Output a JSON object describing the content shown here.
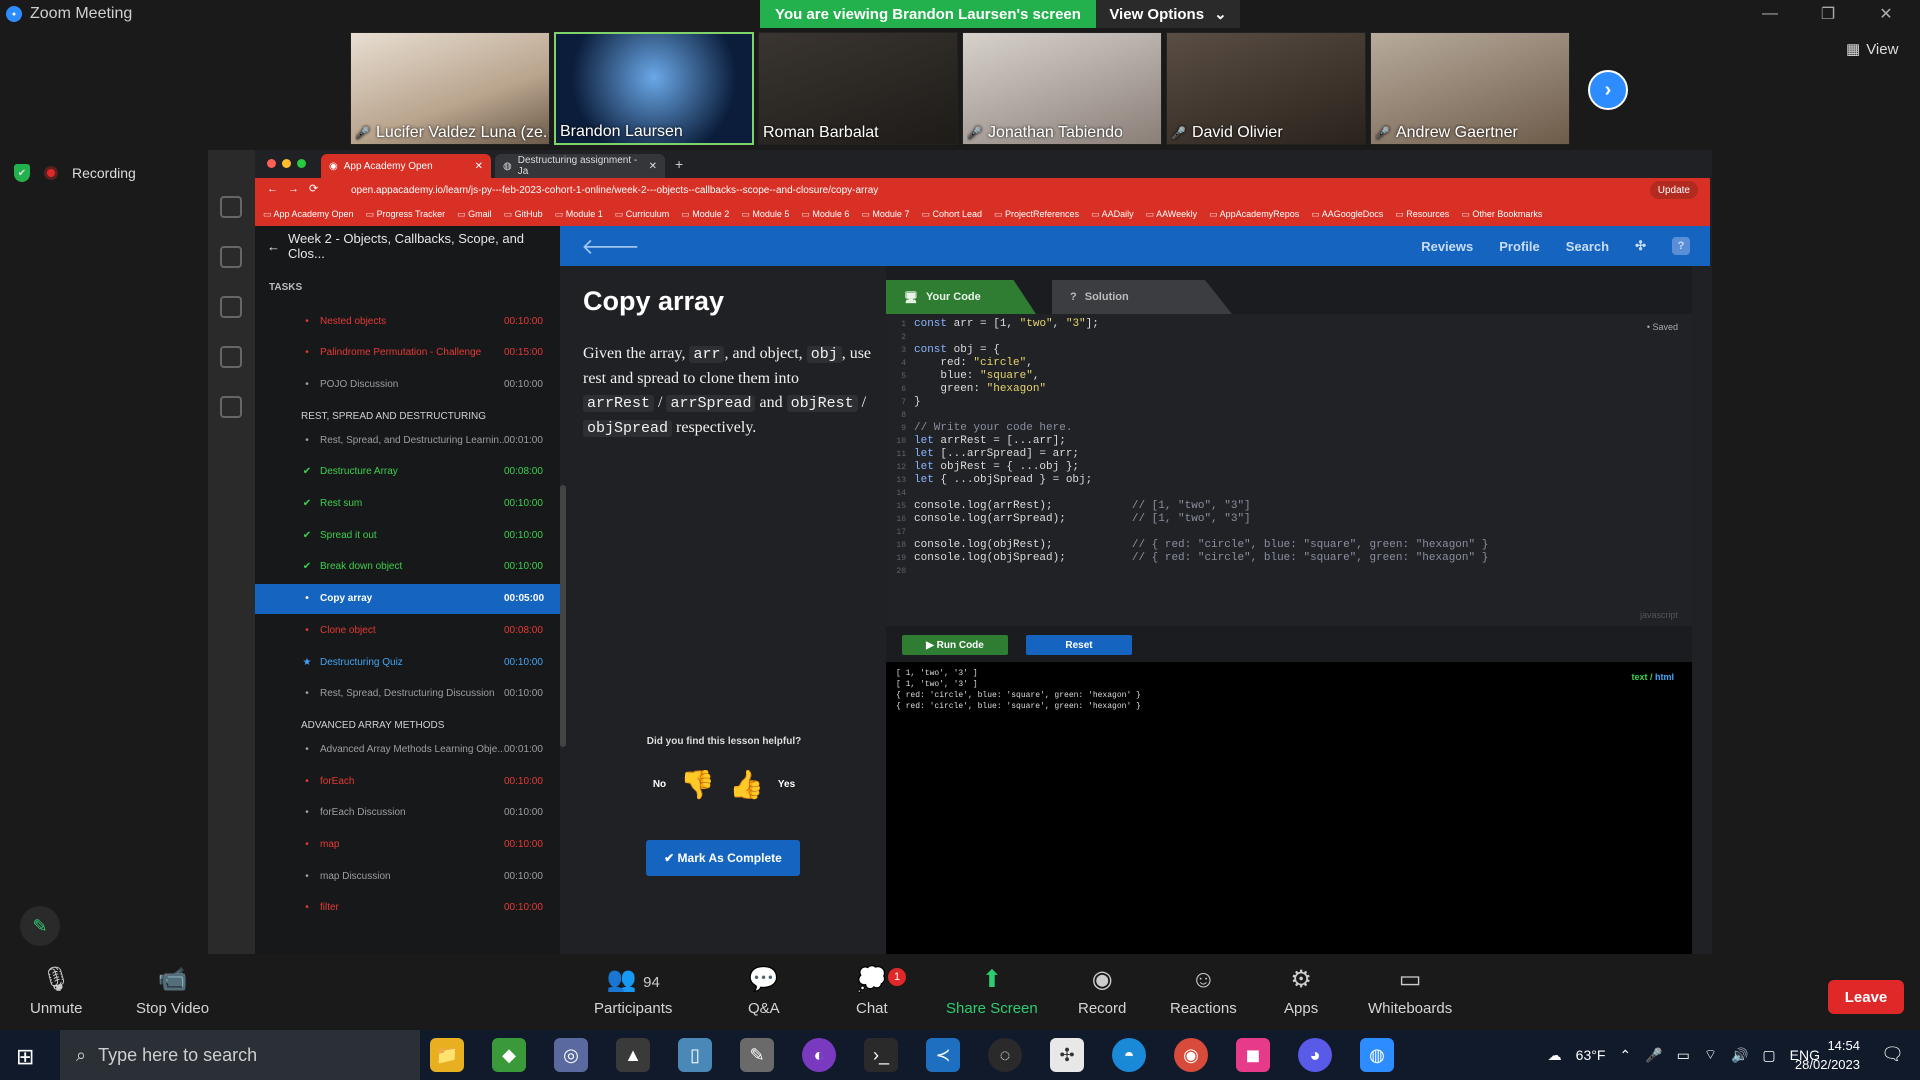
{
  "window": {
    "title": "Zoom Meeting"
  },
  "banner": {
    "viewing": "You are viewing Brandon Laursen's screen",
    "view_options": "View Options"
  },
  "participants": [
    {
      "name": "Lucifer Valdez Luna (ze...",
      "muted": true
    },
    {
      "name": "Brandon Laursen",
      "muted": false
    },
    {
      "name": "Roman Barbalat",
      "muted": false
    },
    {
      "name": "Jonathan Tabiendo",
      "muted": true
    },
    {
      "name": "David Olivier",
      "muted": true
    },
    {
      "name": "Andrew Gaertner",
      "muted": true
    }
  ],
  "view_button": "View",
  "recording": "Recording",
  "browser": {
    "tabs": [
      {
        "label": "App Academy Open"
      },
      {
        "label": "Destructuring assignment - Ja"
      }
    ],
    "url": "open.appacademy.io/learn/js-py---feb-2023-cohort-1-online/week-2---objects--callbacks--scope--and-closure/copy-array",
    "update": "Update",
    "bookmarks": [
      "App Academy Open",
      "Progress Tracker",
      "Gmail",
      "GitHub",
      "Module 1",
      "Curriculum",
      "Module 2",
      "Module 5",
      "Module 6",
      "Module 7",
      "Cohort Lead",
      "ProjectReferences",
      "AADaily",
      "AAWeekly",
      "AppAcademyRepos",
      "AAGoogleDocs",
      "Resources",
      "Other Bookmarks"
    ]
  },
  "aa_nav": {
    "reviews": "Reviews",
    "profile": "Profile",
    "search": "Search",
    "help": "?"
  },
  "sidebar": {
    "title": "Week 2 - Objects, Callbacks, Scope, and Clos...",
    "tasks_label": "TASKS",
    "items": [
      {
        "type": "task",
        "label": "Nested objects",
        "time": "00:10:00",
        "status": "red",
        "icon": "•"
      },
      {
        "type": "task",
        "label": "Palindrome Permutation - Challenge",
        "time": "00:15:00",
        "status": "red",
        "icon": "•"
      },
      {
        "type": "task",
        "label": "POJO Discussion",
        "time": "00:10:00",
        "status": "grey",
        "icon": "•"
      },
      {
        "type": "section",
        "label": "REST, SPREAD AND DESTRUCTURING"
      },
      {
        "type": "task",
        "label": "Rest, Spread, and Destructuring Learnin...",
        "time": "00:01:00",
        "status": "grey",
        "icon": "•"
      },
      {
        "type": "task",
        "label": "Destructure Array",
        "time": "00:08:00",
        "status": "green",
        "icon": "✔"
      },
      {
        "type": "task",
        "label": "Rest sum",
        "time": "00:10:00",
        "status": "green",
        "icon": "✔"
      },
      {
        "type": "task",
        "label": "Spread it out",
        "time": "00:10:00",
        "status": "green",
        "icon": "✔"
      },
      {
        "type": "task",
        "label": "Break down object",
        "time": "00:10:00",
        "status": "green",
        "icon": "✔"
      },
      {
        "type": "task",
        "label": "Copy array",
        "time": "00:05:00",
        "status": "sel",
        "icon": "•"
      },
      {
        "type": "task",
        "label": "Clone object",
        "time": "00:08:00",
        "status": "red",
        "icon": "•"
      },
      {
        "type": "task",
        "label": "Destructuring Quiz",
        "time": "00:10:00",
        "status": "blue",
        "icon": "★"
      },
      {
        "type": "task",
        "label": "Rest, Spread, Destructuring Discussion",
        "time": "00:10:00",
        "status": "grey",
        "icon": "•"
      },
      {
        "type": "section",
        "label": "ADVANCED ARRAY METHODS"
      },
      {
        "type": "task",
        "label": "Advanced Array Methods Learning Obje...",
        "time": "00:01:00",
        "status": "grey",
        "icon": "•"
      },
      {
        "type": "task",
        "label": "forEach",
        "time": "00:10:00",
        "status": "red",
        "icon": "•"
      },
      {
        "type": "task",
        "label": "forEach Discussion",
        "time": "00:10:00",
        "status": "grey",
        "icon": "•"
      },
      {
        "type": "task",
        "label": "map",
        "time": "00:10:00",
        "status": "red",
        "icon": "•"
      },
      {
        "type": "task",
        "label": "map Discussion",
        "time": "00:10:00",
        "status": "grey",
        "icon": "•"
      },
      {
        "type": "task",
        "label": "filter",
        "time": "00:10:00",
        "status": "red",
        "icon": "•"
      }
    ]
  },
  "lesson": {
    "title": "Copy array",
    "desc_parts": [
      "Given the array, ",
      "arr",
      ", and object, ",
      "obj",
      ", use rest and spread to clone them into ",
      "arrRest",
      " / ",
      "arrSpread",
      " and ",
      "objRest",
      " / ",
      "objSpread",
      " respectively."
    ],
    "helpful": "Did you find this lesson helpful?",
    "no": "No",
    "yes": "Yes",
    "mark_complete": "✔ Mark As Complete"
  },
  "editor": {
    "tab_code": "Your Code",
    "tab_solution": "Solution",
    "saved": "Saved",
    "lang": "javascript",
    "lines": [
      "const arr = [1, \"two\", \"3\"];",
      "",
      "const obj = {",
      "    red: \"circle\",",
      "    blue: \"square\",",
      "    green: \"hexagon\"",
      "}",
      "",
      "// Write your code here.",
      "let arrRest = [...arr];",
      "let [...arrSpread] = arr;",
      "let objRest = { ...obj };",
      "let { ...objSpread } = obj;",
      "",
      "console.log(arrRest);            // [1, \"two\", \"3\"]",
      "console.log(arrSpread);          // [1, \"two\", \"3\"]",
      "",
      "console.log(objRest);            // { red: \"circle\", blue: \"square\", green: \"hexagon\" }",
      "console.log(objSpread);          // { red: \"circle\", blue: \"square\", green: \"hexagon\" }",
      ""
    ],
    "run": "▶ Run Code",
    "reset": "Reset",
    "output_mode_a": "text",
    "output_mode_b": "html",
    "output": [
      "[ 1, 'two', '3' ]",
      "[ 1, 'two', '3' ]",
      "{ red: 'circle', blue: 'square', green: 'hexagon' }",
      "{ red: 'circle', blue: 'square', green: 'hexagon' }"
    ]
  },
  "toolbar": {
    "unmute": "Unmute",
    "stop_video": "Stop Video",
    "participants": "Participants",
    "participant_count": "94",
    "qa": "Q&A",
    "chat": "Chat",
    "chat_badge": "1",
    "share": "Share Screen",
    "record": "Record",
    "reactions": "Reactions",
    "apps": "Apps",
    "whiteboards": "Whiteboards",
    "leave": "Leave"
  },
  "taskbar": {
    "search_placeholder": "Type here to search",
    "weather": "63°F",
    "lang": "ENG",
    "time": "14:54",
    "date": "28/02/2023"
  }
}
